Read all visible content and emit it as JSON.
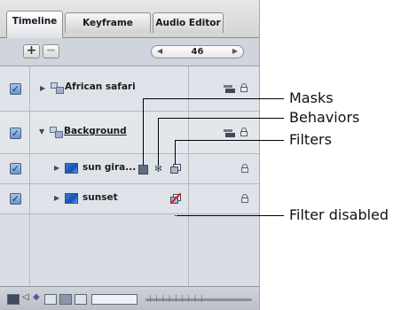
{
  "tabs": [
    {
      "label": "Timeline",
      "active": true
    },
    {
      "label": "Keyframe Editor",
      "active": false
    },
    {
      "label": "Audio Editor",
      "active": false
    }
  ],
  "toolbar": {
    "add_label": "+",
    "remove_label": "−",
    "frame_value": "46"
  },
  "layers": [
    {
      "name": "African safari",
      "type": "group",
      "expanded": false,
      "enabled": true
    },
    {
      "name": "Background",
      "type": "group",
      "expanded": true,
      "enabled": true
    },
    {
      "name": "sun gira...",
      "type": "layer",
      "expanded": false,
      "enabled": true,
      "has_mask": true,
      "has_behavior": true,
      "has_filter": true
    },
    {
      "name": "sunset",
      "type": "layer",
      "expanded": false,
      "enabled": true,
      "filter_disabled": true
    }
  ],
  "callouts": {
    "masks": "Masks",
    "behaviors": "Behaviors",
    "filters": "Filters",
    "filter_disabled": "Filter disabled"
  },
  "colors": {
    "panel_bg": "#d9dde4",
    "checkbox": "#7a9bd0",
    "thumb": "#2d63c8",
    "disabled_slash": "#d02020"
  }
}
